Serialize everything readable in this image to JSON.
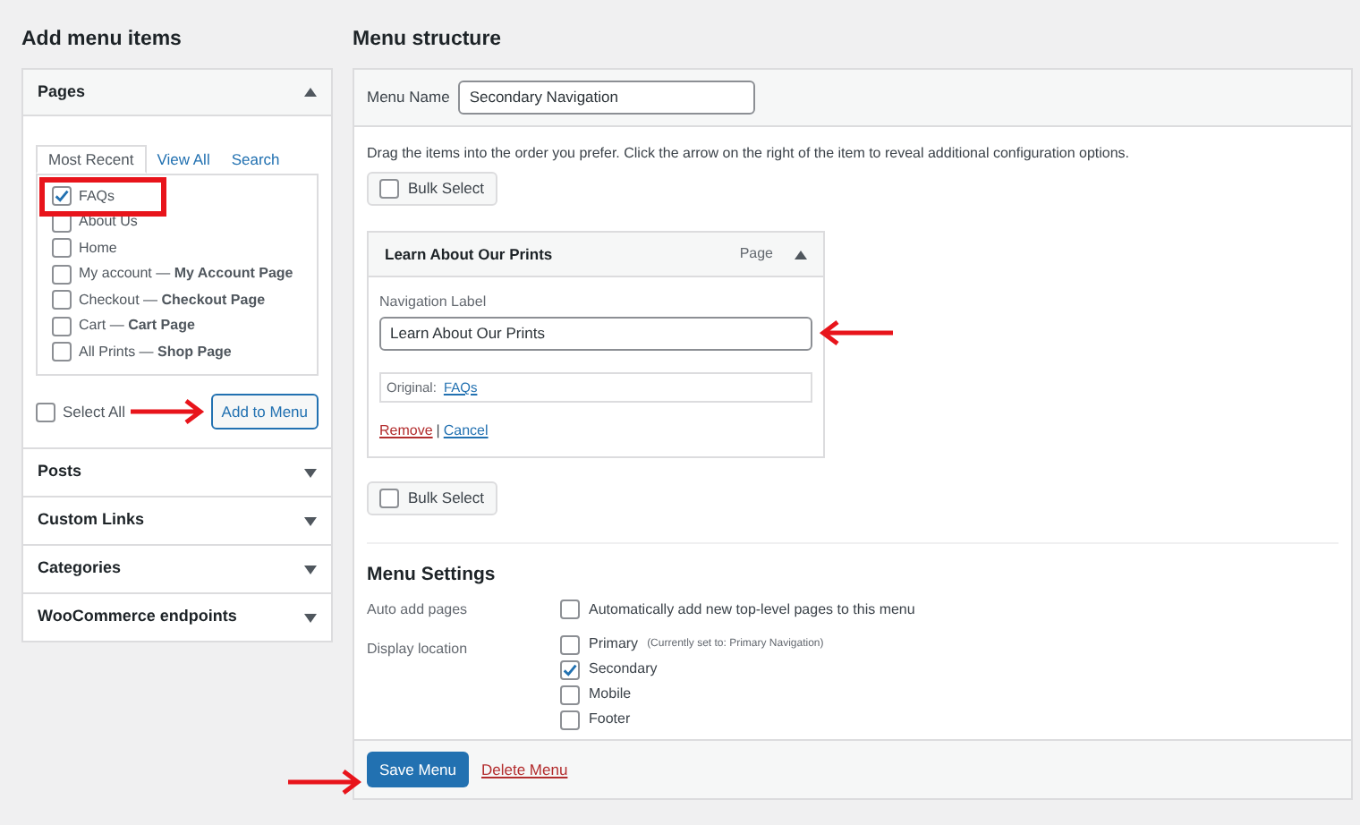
{
  "add_items": {
    "heading": "Add menu items",
    "sections": [
      {
        "title": "Pages",
        "expanded": true
      },
      {
        "title": "Posts",
        "expanded": false
      },
      {
        "title": "Custom Links",
        "expanded": false
      },
      {
        "title": "Categories",
        "expanded": false
      },
      {
        "title": "WooCommerce endpoints",
        "expanded": false
      }
    ],
    "tabs": [
      {
        "label": "Most Recent",
        "selected": true
      },
      {
        "label": "View All",
        "selected": false
      },
      {
        "label": "Search",
        "selected": false
      }
    ],
    "pages": [
      {
        "label": "FAQs",
        "checked": true
      },
      {
        "label": "About Us",
        "checked": false
      },
      {
        "label": "Home",
        "checked": false
      },
      {
        "label": "My account — **My Account Page**",
        "checked": false
      },
      {
        "label": "Checkout — **Checkout Page**",
        "checked": false
      },
      {
        "label": "Cart — **Cart Page**",
        "checked": false
      },
      {
        "label": "All Prints — **Shop Page**",
        "checked": false
      }
    ],
    "select_all": {
      "label": "Select All",
      "checked": false
    },
    "add_button": "Add to Menu"
  },
  "structure": {
    "heading": "Menu structure",
    "menu_name_label": "Menu Name",
    "menu_name_value": "Secondary Navigation",
    "instructions": "Drag the items into the order you prefer. Click the arrow on the right of the item to reveal additional configuration options.",
    "bulk_select_top": {
      "label": "Bulk Select",
      "checked": false
    },
    "item": {
      "title": "Learn About Our Prints",
      "type": "Page",
      "expanded": true,
      "field_label": "Navigation Label",
      "field_value": "Learn About Our Prints",
      "original_label": "Original:",
      "original_link": "FAQs",
      "remove": "Remove",
      "separator": "|",
      "cancel": "Cancel"
    },
    "bulk_select_bottom": {
      "label": "Bulk Select",
      "checked": false
    },
    "settings": {
      "heading": "Menu Settings",
      "auto_add_label": "Auto add pages",
      "auto_add": {
        "label": "Automatically add new top-level pages to this menu",
        "checked": false
      },
      "location_label": "Display location",
      "locations": [
        {
          "label": "Primary",
          "note": "(Currently set to: Primary Navigation)",
          "checked": false
        },
        {
          "label": "Secondary",
          "checked": true
        },
        {
          "label": "Mobile",
          "checked": false
        },
        {
          "label": "Footer",
          "checked": false
        }
      ]
    },
    "save": "Save Menu",
    "delete": "Delete Menu"
  }
}
